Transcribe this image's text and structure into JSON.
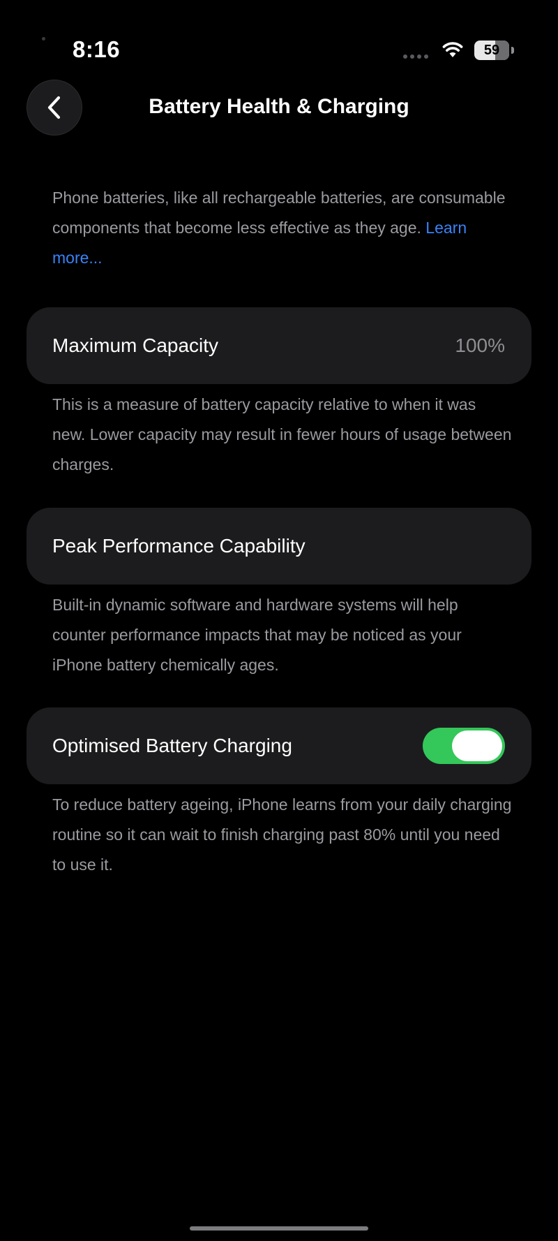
{
  "status_bar": {
    "time": "8:16",
    "battery_level": "59",
    "battery_fraction": 0.59,
    "icons": [
      "signal-dots-icon",
      "wifi-icon",
      "battery-icon"
    ]
  },
  "nav": {
    "back_icon": "chevron-left-icon",
    "title": "Battery Health & Charging"
  },
  "intro": {
    "text": "Phone batteries, like all rechargeable batteries, are consumable components that become less effective as they age.",
    "link": "Learn more..."
  },
  "maximum_capacity": {
    "label": "Maximum Capacity",
    "value": "100%",
    "description": "This is a measure of battery capacity relative to when it was new. Lower capacity may result in fewer hours of usage between charges."
  },
  "peak_performance": {
    "label": "Peak Performance Capability",
    "description": "Built-in dynamic software and hardware systems will help counter performance impacts that may be noticed as your iPhone battery chemically ages."
  },
  "optimised_charging": {
    "label": "Optimised Battery Charging",
    "enabled": true,
    "description": "To reduce battery ageing, iPhone learns from your daily charging routine so it can wait to finish charging past 80% until you need to use it."
  },
  "colors": {
    "background": "#000000",
    "card": "#1c1c1e",
    "accent_link": "#3a82f7",
    "toggle_on": "#34c759",
    "secondary_text": "#9a9aa0"
  }
}
